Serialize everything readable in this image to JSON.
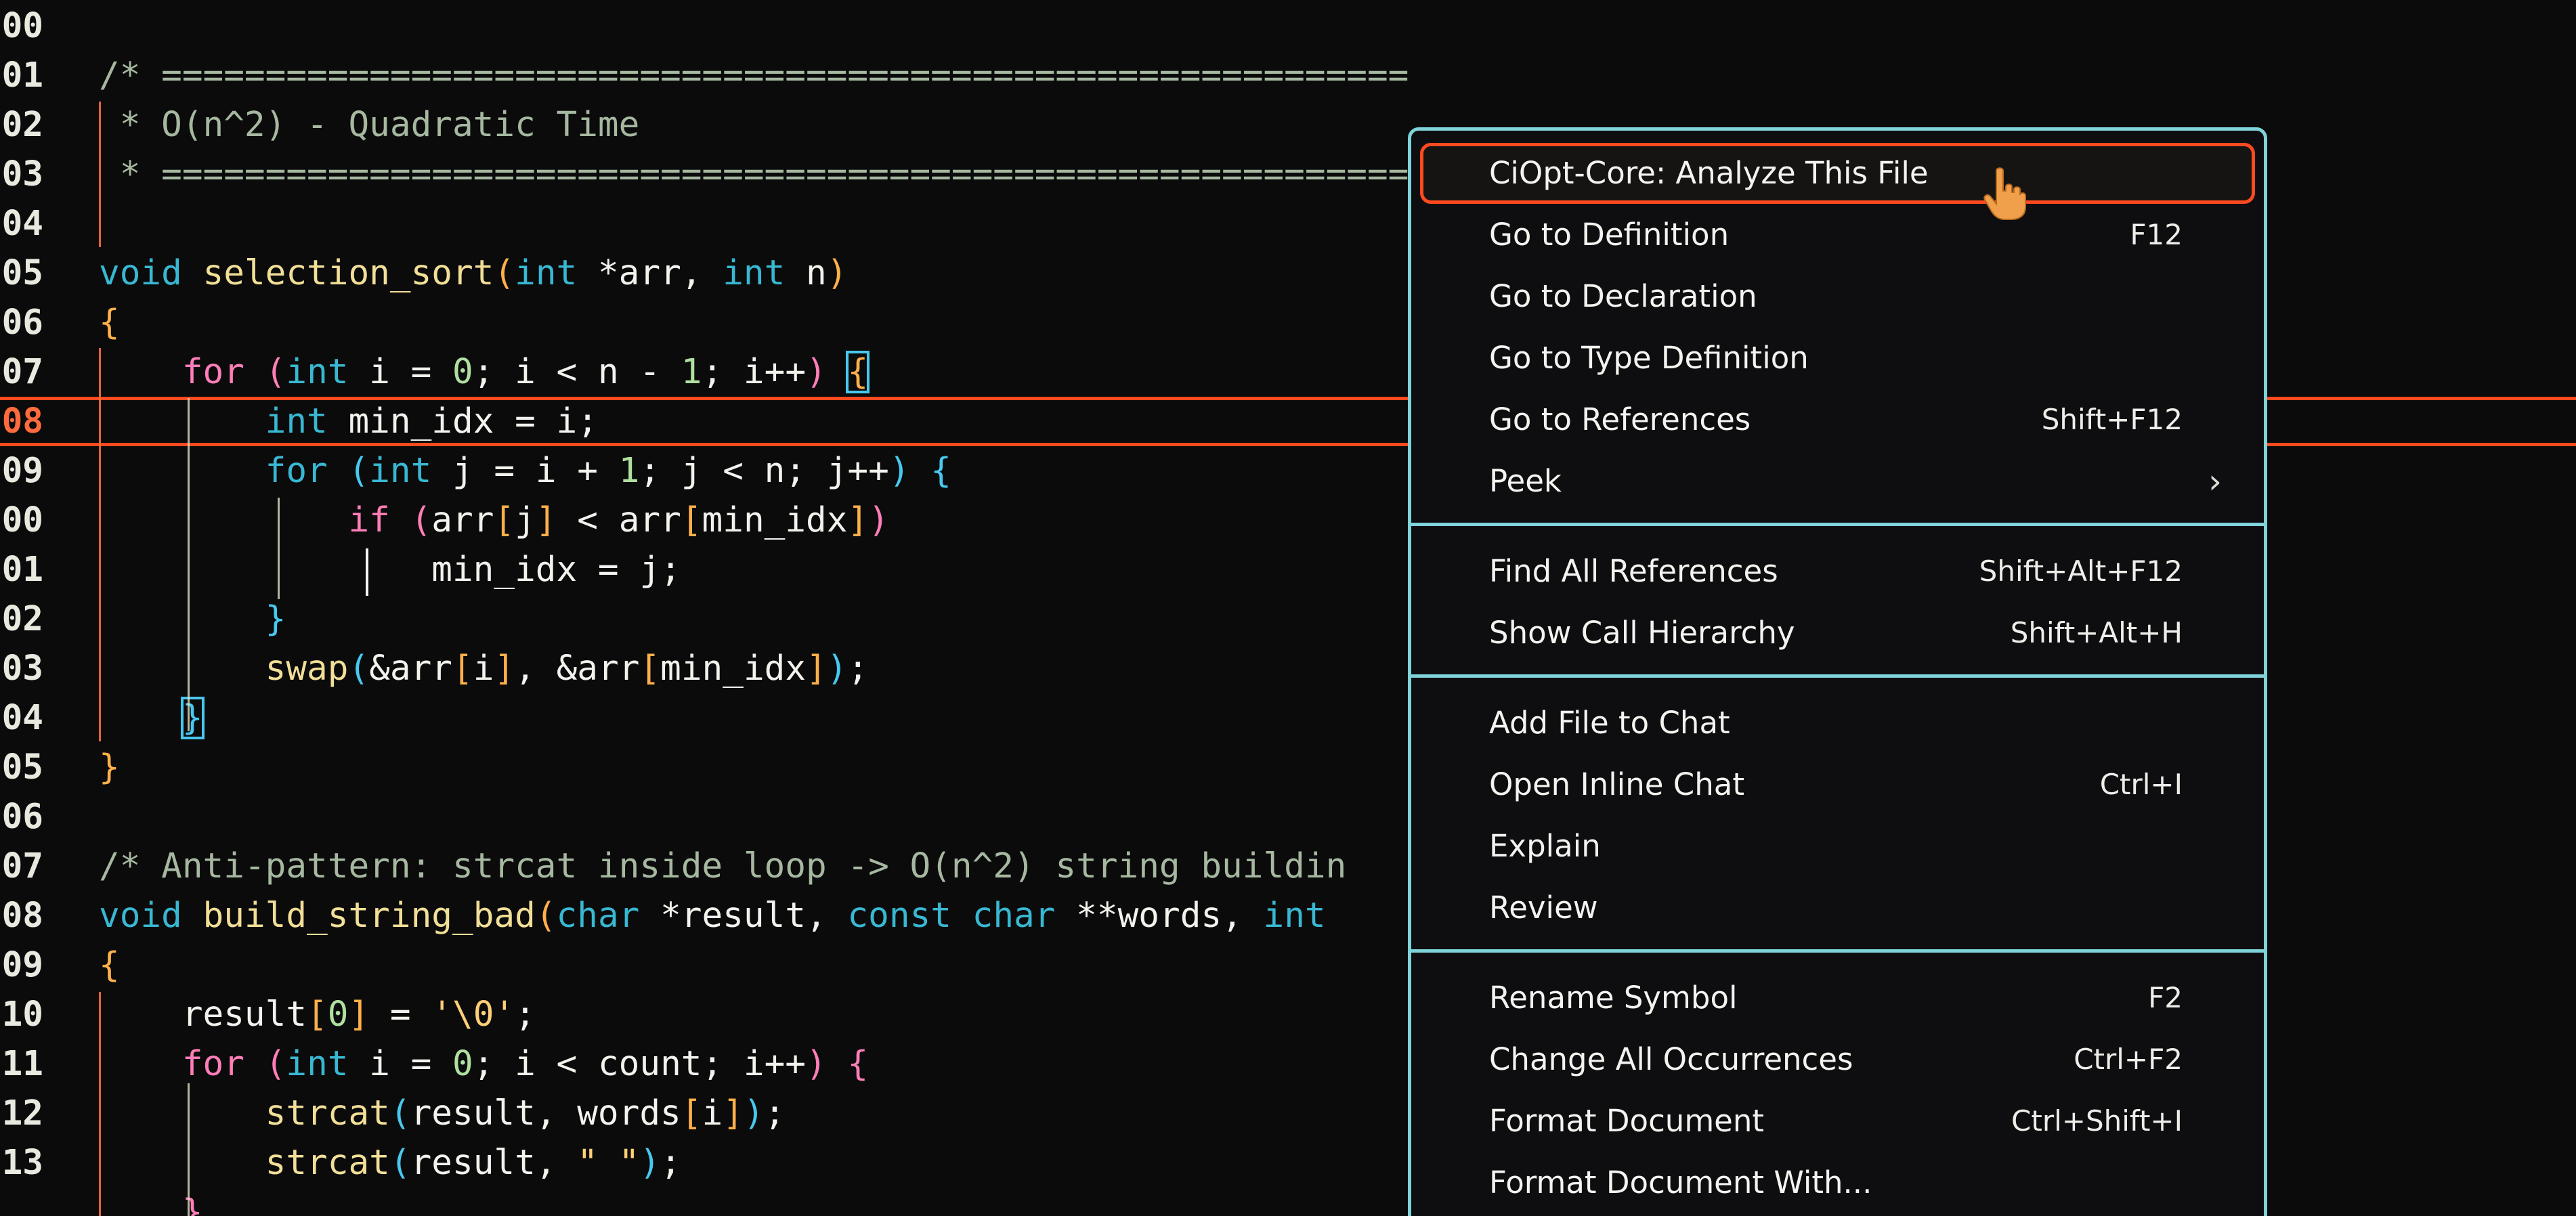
{
  "editor": {
    "lines": [
      {
        "num": "00",
        "tokens": []
      },
      {
        "num": "01",
        "tokens": [
          {
            "t": "/* ============================================================",
            "c": "t-cm"
          }
        ]
      },
      {
        "num": "02",
        "tokens": [
          {
            "t": " * O(n^2) - Quadratic Time",
            "c": "t-cm"
          }
        ]
      },
      {
        "num": "03",
        "tokens": [
          {
            "t": " * ============================================================",
            "c": "t-cm"
          }
        ]
      },
      {
        "num": "04",
        "tokens": []
      },
      {
        "num": "05",
        "tokens": [
          {
            "t": "void ",
            "c": "t-kw"
          },
          {
            "t": "selection_sort",
            "c": "t-fn"
          },
          {
            "t": "(",
            "c": "t-brk"
          },
          {
            "t": "int ",
            "c": "t-kw"
          },
          {
            "t": "*arr, ",
            "c": "t-var"
          },
          {
            "t": "int ",
            "c": "t-kw"
          },
          {
            "t": "n",
            "c": "t-var"
          },
          {
            "t": ")",
            "c": "t-brk"
          }
        ]
      },
      {
        "num": "06",
        "tokens": [
          {
            "t": "{",
            "c": "t-brk"
          }
        ]
      },
      {
        "num": "07",
        "tokens": [
          {
            "t": "    for ",
            "c": "t-brk2"
          },
          {
            "t": "(",
            "c": "t-brk2"
          },
          {
            "t": "int ",
            "c": "t-kw"
          },
          {
            "t": "i = ",
            "c": "t-var"
          },
          {
            "t": "0",
            "c": "t-num"
          },
          {
            "t": "; i < n - ",
            "c": "t-var"
          },
          {
            "t": "1",
            "c": "t-num"
          },
          {
            "t": "; i++",
            "c": "t-var"
          },
          {
            "t": ")",
            "c": "t-brk2"
          },
          {
            "t": " ",
            "c": "t-var"
          },
          {
            "t": "{",
            "c": "t-brk",
            "box": true
          }
        ]
      },
      {
        "num": "08",
        "tokens": [
          {
            "t": "        int ",
            "c": "t-kw"
          },
          {
            "t": "min_idx = i;",
            "c": "t-var"
          }
        ]
      },
      {
        "num": "09",
        "tokens": [
          {
            "t": "        for ",
            "c": "t-kw"
          },
          {
            "t": "(",
            "c": "t-brk3"
          },
          {
            "t": "int ",
            "c": "t-kw"
          },
          {
            "t": "j = i + ",
            "c": "t-var"
          },
          {
            "t": "1",
            "c": "t-num"
          },
          {
            "t": "; j < n; j++",
            "c": "t-var"
          },
          {
            "t": ")",
            "c": "t-brk3"
          },
          {
            "t": " {",
            "c": "t-brk3"
          }
        ]
      },
      {
        "num": "00",
        "tokens": [
          {
            "t": "            if ",
            "c": "t-brk2"
          },
          {
            "t": "(",
            "c": "t-brk2"
          },
          {
            "t": "arr",
            "c": "t-var"
          },
          {
            "t": "[",
            "c": "t-brk"
          },
          {
            "t": "j",
            "c": "t-var"
          },
          {
            "t": "]",
            "c": "t-brk"
          },
          {
            "t": " < arr",
            "c": "t-var"
          },
          {
            "t": "[",
            "c": "t-brk"
          },
          {
            "t": "min_idx",
            "c": "t-var"
          },
          {
            "t": "]",
            "c": "t-brk"
          },
          {
            "t": ")",
            "c": "t-brk2"
          }
        ]
      },
      {
        "num": "01",
        "tokens": [
          {
            "t": "                min_idx = j;",
            "c": "t-var"
          }
        ]
      },
      {
        "num": "02",
        "tokens": [
          {
            "t": "        }",
            "c": "t-brk3"
          }
        ]
      },
      {
        "num": "03",
        "tokens": [
          {
            "t": "        swap",
            "c": "t-fn"
          },
          {
            "t": "(",
            "c": "t-brk3"
          },
          {
            "t": "&arr",
            "c": "t-var"
          },
          {
            "t": "[",
            "c": "t-brk"
          },
          {
            "t": "i",
            "c": "t-var"
          },
          {
            "t": "]",
            "c": "t-brk"
          },
          {
            "t": ", &arr",
            "c": "t-var"
          },
          {
            "t": "[",
            "c": "t-brk"
          },
          {
            "t": "min_idx",
            "c": "t-var"
          },
          {
            "t": "]",
            "c": "t-brk"
          },
          {
            "t": ")",
            "c": "t-brk3"
          },
          {
            "t": ";",
            "c": "t-var"
          }
        ]
      },
      {
        "num": "04",
        "tokens": [
          {
            "t": "    ",
            "c": "t-var"
          },
          {
            "t": "}",
            "c": "t-brk3",
            "box": true
          }
        ]
      },
      {
        "num": "05",
        "tokens": [
          {
            "t": "}",
            "c": "t-brk"
          }
        ]
      },
      {
        "num": "06",
        "tokens": []
      },
      {
        "num": "07",
        "tokens": [
          {
            "t": "/* Anti-pattern: strcat inside loop -> O(n^2) string buildin",
            "c": "t-cm"
          }
        ]
      },
      {
        "num": "08",
        "tokens": [
          {
            "t": "void ",
            "c": "t-kw"
          },
          {
            "t": "build_string_bad",
            "c": "t-fn"
          },
          {
            "t": "(",
            "c": "t-brk"
          },
          {
            "t": "char ",
            "c": "t-kw"
          },
          {
            "t": "*result, ",
            "c": "t-var"
          },
          {
            "t": "const char ",
            "c": "t-kw"
          },
          {
            "t": "**words, ",
            "c": "t-var"
          },
          {
            "t": "int",
            "c": "t-kw"
          }
        ]
      },
      {
        "num": "09",
        "tokens": [
          {
            "t": "{",
            "c": "t-brk"
          }
        ]
      },
      {
        "num": "10",
        "tokens": [
          {
            "t": "    result",
            "c": "t-var"
          },
          {
            "t": "[",
            "c": "t-brk"
          },
          {
            "t": "0",
            "c": "t-num"
          },
          {
            "t": "]",
            "c": "t-brk"
          },
          {
            "t": " = ",
            "c": "t-var"
          },
          {
            "t": "'\\0'",
            "c": "t-str"
          },
          {
            "t": ";",
            "c": "t-var"
          }
        ]
      },
      {
        "num": "11",
        "tokens": [
          {
            "t": "    for ",
            "c": "t-brk2"
          },
          {
            "t": "(",
            "c": "t-brk2"
          },
          {
            "t": "int ",
            "c": "t-kw"
          },
          {
            "t": "i = ",
            "c": "t-var"
          },
          {
            "t": "0",
            "c": "t-num"
          },
          {
            "t": "; i < count; i++",
            "c": "t-var"
          },
          {
            "t": ")",
            "c": "t-brk2"
          },
          {
            "t": " {",
            "c": "t-brk2"
          }
        ]
      },
      {
        "num": "12",
        "tokens": [
          {
            "t": "        strcat",
            "c": "t-fn"
          },
          {
            "t": "(",
            "c": "t-brk3"
          },
          {
            "t": "result, words",
            "c": "t-var"
          },
          {
            "t": "[",
            "c": "t-brk"
          },
          {
            "t": "i",
            "c": "t-var"
          },
          {
            "t": "]",
            "c": "t-brk"
          },
          {
            "t": ")",
            "c": "t-brk3"
          },
          {
            "t": ";",
            "c": "t-var"
          }
        ]
      },
      {
        "num": "13",
        "tokens": [
          {
            "t": "        strcat",
            "c": "t-fn"
          },
          {
            "t": "(",
            "c": "t-brk3"
          },
          {
            "t": "result, ",
            "c": "t-var"
          },
          {
            "t": "\" \"",
            "c": "t-str"
          },
          {
            "t": ")",
            "c": "t-brk3"
          },
          {
            "t": ";",
            "c": "t-var"
          }
        ]
      },
      {
        "num": "",
        "tokens": [
          {
            "t": "    }",
            "c": "t-brk2"
          }
        ]
      }
    ]
  },
  "context_menu": {
    "groups": [
      [
        {
          "label": "CiOpt-Core: Analyze This File",
          "shortcut": "",
          "selected": true
        },
        {
          "label": "Go to Definition",
          "shortcut": "F12"
        },
        {
          "label": "Go to Declaration",
          "shortcut": ""
        },
        {
          "label": "Go to Type Definition",
          "shortcut": ""
        },
        {
          "label": "Go to References",
          "shortcut": "Shift+F12"
        },
        {
          "label": "Peek",
          "shortcut": "",
          "submenu": true
        }
      ],
      [
        {
          "label": "Find All References",
          "shortcut": "Shift+Alt+F12"
        },
        {
          "label": "Show Call Hierarchy",
          "shortcut": "Shift+Alt+H"
        }
      ],
      [
        {
          "label": "Add File to Chat",
          "shortcut": ""
        },
        {
          "label": "Open Inline Chat",
          "shortcut": "Ctrl+I"
        },
        {
          "label": "Explain",
          "shortcut": ""
        },
        {
          "label": "Review",
          "shortcut": ""
        }
      ],
      [
        {
          "label": "Rename Symbol",
          "shortcut": "F2"
        },
        {
          "label": "Change All Occurrences",
          "shortcut": "Ctrl+F2"
        },
        {
          "label": "Format Document",
          "shortcut": "Ctrl+Shift+I"
        },
        {
          "label": "Format Document With...",
          "shortcut": ""
        }
      ]
    ],
    "submenu_glyph": "›"
  },
  "colors": {
    "highlight_border": "#ff4a1f",
    "menu_border": "#7fd3da",
    "background": "#0b0b0c"
  },
  "icons": {
    "cursor": "pointer-hand-icon"
  }
}
